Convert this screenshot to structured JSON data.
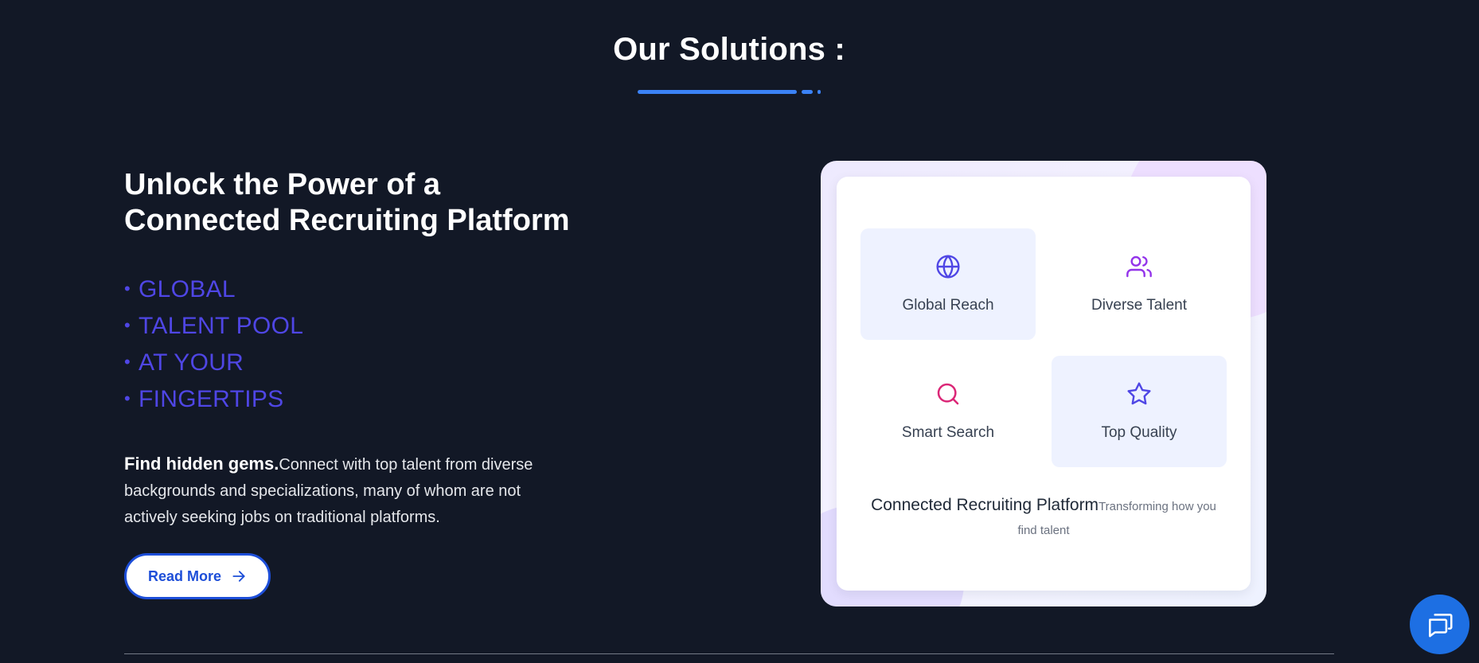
{
  "section": {
    "title": "Our Solutions :"
  },
  "hero": {
    "headline_line1": "Unlock the Power of a",
    "headline_line2": "Connected Recruiting Platform",
    "features": [
      "GLOBAL",
      "TALENT POOL",
      "AT YOUR",
      "FINGERTIPS"
    ],
    "bullet": "•",
    "description_strong": "Find hidden gems.",
    "description_rest": "Connect with top talent from diverse backgrounds and specializations, many of whom are not actively seeking jobs on traditional platforms.",
    "read_more_label": "Read More"
  },
  "card": {
    "tiles": [
      {
        "label": "Global Reach",
        "icon": "globe-icon",
        "color": "#4f46e5"
      },
      {
        "label": "Diverse Talent",
        "icon": "users-icon",
        "color": "#9333ea"
      },
      {
        "label": "Smart Search",
        "icon": "search-icon",
        "color": "#db2777"
      },
      {
        "label": "Top Quality",
        "icon": "star-icon",
        "color": "#4f46e5"
      }
    ],
    "caption_title": "Connected Recruiting Platform",
    "caption_subtitle": "Transforming how you find talent"
  },
  "chat": {
    "icon": "chat-icon"
  },
  "colors": {
    "background": "#121826",
    "accent": "#3b82f6",
    "feature_text": "#4f46e5",
    "button_border": "#1d4ed8",
    "chat_button": "#1d6fe3"
  }
}
